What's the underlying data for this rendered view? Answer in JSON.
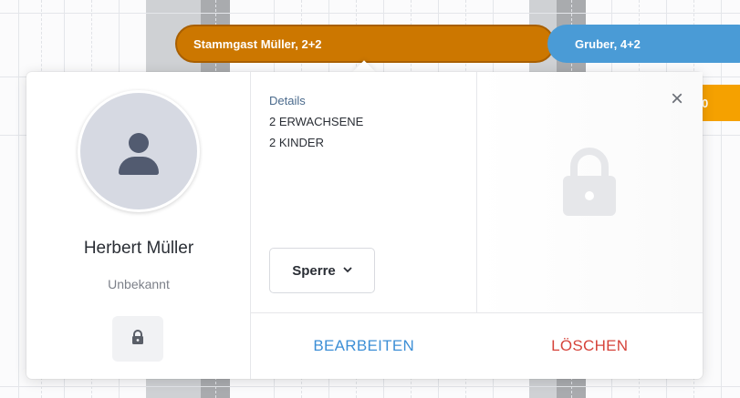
{
  "calendar": {
    "bars": [
      {
        "label": "Stammgast Müller, 2+2",
        "color": "#cc7700"
      },
      {
        "label": "Gruber, 4+2",
        "color": "#4a9bd6"
      },
      {
        "label": "0",
        "color": "#f5a100"
      }
    ]
  },
  "popup": {
    "guest": {
      "name": "Herbert Müller",
      "status": "Unbekannt",
      "avatar_icon": "user-icon",
      "lock_icon": "lock-icon"
    },
    "details": {
      "label": "Details",
      "lines": [
        "2 ERWACHSENE",
        "2 KINDER"
      ]
    },
    "sperre": {
      "label": "Sperre",
      "chevron_icon": "chevron-down-icon"
    },
    "right_panel": {
      "icon": "lock-icon"
    },
    "close_icon": "close-icon",
    "footer": {
      "edit_label": "BEARBEITEN",
      "delete_label": "LÖSCHEN"
    },
    "colors": {
      "edit": "#3d8fd6",
      "delete": "#d6443b"
    }
  }
}
